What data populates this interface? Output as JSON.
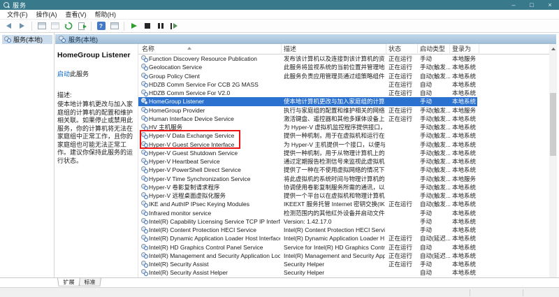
{
  "window": {
    "title": "服务",
    "controls": {
      "minimize": "–",
      "maximize": "□",
      "close": "×"
    }
  },
  "menu": {
    "items": [
      {
        "label": "文件(F)"
      },
      {
        "label": "操作(A)"
      },
      {
        "label": "查看(V)"
      },
      {
        "label": "帮助(H)"
      }
    ]
  },
  "toolbar": {
    "icons": [
      "back-icon",
      "forward-icon",
      "show-console-tree-icon",
      "properties-icon",
      "refresh-icon",
      "export-list-icon",
      "help-icon",
      "show-action-pane-icon",
      "start-service-icon",
      "stop-service-icon",
      "pause-service-icon",
      "restart-service-icon"
    ],
    "help_glyph": "?"
  },
  "tree": {
    "root_label": "服务(本地)"
  },
  "banner": {
    "title": "服务(本地)"
  },
  "detail_pane": {
    "service_name": "HomeGroup Listener",
    "start_link": "启动",
    "start_suffix": "此服务",
    "description_label": "描述:",
    "description": "使本地计算机更改与加入家庭组的计算机的配置和维护相关联。如果停止或禁用此服务，你的计算机将无法在家庭组中正常工作，且你的家庭组也可能无法正常工作。建议你保持此服务的运行状态。"
  },
  "list": {
    "columns": [
      "名称",
      "描述",
      "状态",
      "启动类型",
      "登录为"
    ],
    "rows": [
      {
        "name": "Function Discovery Resource Publication",
        "desc": "发布该计算机以及连接到该计算机的资源...",
        "status": "正在运行",
        "startup": "手动",
        "logon": "本地服务",
        "selected": false
      },
      {
        "name": "Geolocation Service",
        "desc": "此服务将监视系统的当前位置并管理地理...",
        "status": "正在运行",
        "startup": "手动(触发...",
        "logon": "本地系统",
        "selected": false
      },
      {
        "name": "Group Policy Client",
        "desc": "此服务负责应用管理员通过组策略组件为...",
        "status": "正在运行",
        "startup": "自动(触发...",
        "logon": "本地系统",
        "selected": false
      },
      {
        "name": "HDZB Comm Service For CCB 2G MASS",
        "desc": "",
        "status": "正在运行",
        "startup": "自动",
        "logon": "本地系统",
        "selected": false
      },
      {
        "name": "HDZB Comm Service For V2.0",
        "desc": "",
        "status": "正在运行",
        "startup": "自动",
        "logon": "本地系统",
        "selected": false
      },
      {
        "name": "HomeGroup Listener",
        "desc": "使本地计算机更改与加入家庭组的计算机...",
        "status": "",
        "startup": "手动",
        "logon": "本地系统",
        "selected": true
      },
      {
        "name": "HomeGroup Provider",
        "desc": "执行与家庭组的配置和维护相关的网络任...",
        "status": "正在运行",
        "startup": "手动(触发...",
        "logon": "本地服务",
        "selected": false
      },
      {
        "name": "Human Interface Device Service",
        "desc": "激活键盘、遥控器和其他多媒体设备上的...",
        "status": "正在运行",
        "startup": "手动(触发...",
        "logon": "本地系统",
        "selected": false
      },
      {
        "name": "HV 主机服务",
        "desc": "为 Hyper-V 虚拟机监控程序提供接口，以...",
        "status": "",
        "startup": "手动(触发...",
        "logon": "本地系统",
        "selected": false
      },
      {
        "name": "Hyper-V Data Exchange Service",
        "desc": "提供一种机制，用于在虚拟机和运行在物...",
        "status": "",
        "startup": "手动(触发...",
        "logon": "本地系统",
        "selected": false
      },
      {
        "name": "Hyper-V Guest Service Interface",
        "desc": "为 Hyper-V 主机提供一个接口，以便与虚...",
        "status": "",
        "startup": "手动(触发...",
        "logon": "本地系统",
        "selected": false
      },
      {
        "name": "Hyper-V Guest Shutdown Service",
        "desc": "提供一种机制，用于从物理计算机上的管...",
        "status": "",
        "startup": "手动(触发...",
        "logon": "本地系统",
        "selected": false
      },
      {
        "name": "Hyper-V Heartbeat Service",
        "desc": "通过定期报告检测信号来监视此虚拟机的...",
        "status": "",
        "startup": "手动(触发...",
        "logon": "本地系统",
        "selected": false
      },
      {
        "name": "Hyper-V PowerShell Direct Service",
        "desc": "提供了一种在不使用虚拟网络的情况下，...",
        "status": "",
        "startup": "手动(触发...",
        "logon": "本地系统",
        "selected": false
      },
      {
        "name": "Hyper-V Time Synchronization Service",
        "desc": "将此虚拟机的系统时间与物理计算机的系...",
        "status": "",
        "startup": "手动(触发...",
        "logon": "本地服务",
        "selected": false
      },
      {
        "name": "Hyper-V 卷影复制请求程序",
        "desc": "协调使用卷影复制服务所需的通讯，以从...",
        "status": "",
        "startup": "手动(触发...",
        "logon": "本地系统",
        "selected": false
      },
      {
        "name": "Hyper-V 远程桌面虚拟化服务",
        "desc": "提供一个平台以在虚拟机和物理计算机上...",
        "status": "",
        "startup": "手动(触发...",
        "logon": "本地系统",
        "selected": false
      },
      {
        "name": "IKE and AuthIP IPsec Keying Modules",
        "desc": "IKEEXT 服务托管 Internet 密钥交换(IKE)...",
        "status": "正在运行",
        "startup": "自动(触发...",
        "logon": "本地系统",
        "selected": false
      },
      {
        "name": "Infrared monitor service",
        "desc": "检测范围内的其他红外设备并启动文件传...",
        "status": "",
        "startup": "手动",
        "logon": "本地系统",
        "selected": false
      },
      {
        "name": "Intel(R) Capability Licensing Service TCP IP Interface",
        "desc": "Version: 1.42.17.0",
        "status": "",
        "startup": "手动",
        "logon": "本地系统",
        "selected": false
      },
      {
        "name": "Intel(R) Content Protection HECI Service",
        "desc": "Intel(R) Content Protection HECI Servic...",
        "status": "",
        "startup": "手动",
        "logon": "本地系统",
        "selected": false
      },
      {
        "name": "Intel(R) Dynamic Application Loader Host Interface ...",
        "desc": "Intel(R) Dynamic Application Loader H...",
        "status": "正在运行",
        "startup": "自动(延迟...",
        "logon": "本地系统",
        "selected": false
      },
      {
        "name": "Intel(R) HD Graphics Control Panel Service",
        "desc": "Service for Intel(R) HD Graphics Contr...",
        "status": "正在运行",
        "startup": "自动",
        "logon": "本地系统",
        "selected": false
      },
      {
        "name": "Intel(R) Management and Security Application Local...",
        "desc": "Intel(R) Management and Security App...",
        "status": "正在运行",
        "startup": "自动(延迟...",
        "logon": "本地系统",
        "selected": false
      },
      {
        "name": "Intel(R) Security Assist",
        "desc": "Security Helper",
        "status": "正在运行",
        "startup": "手动",
        "logon": "本地系统",
        "selected": false
      },
      {
        "name": "Intel(R) Security Assist Helper",
        "desc": "Security Helper",
        "status": "",
        "startup": "自动",
        "logon": "本地系统",
        "selected": false
      }
    ]
  },
  "tabs": {
    "items": [
      {
        "label": "扩展"
      },
      {
        "label": "标准"
      }
    ]
  },
  "colors": {
    "titlebar": "#38798b",
    "selection": "#2a71d0",
    "banner_top": "#c3d9ec",
    "banner_bottom": "#9fbcd6",
    "annotation_red": "#ee1111",
    "link": "#0563c1"
  }
}
